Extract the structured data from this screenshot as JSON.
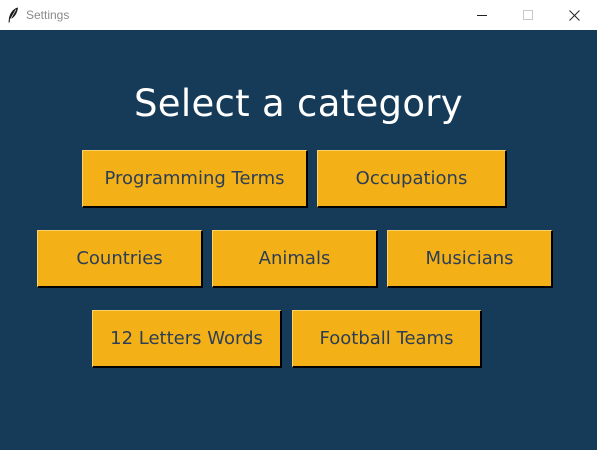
{
  "window": {
    "title": "Settings",
    "app_icon": "feather-icon",
    "controls": {
      "minimize_icon": "minimize-icon",
      "maximize_icon": "maximize-icon",
      "close_icon": "close-icon"
    }
  },
  "main": {
    "heading": "Select a category",
    "categories": [
      {
        "label": "Programming Terms"
      },
      {
        "label": "Occupations"
      },
      {
        "label": "Countries"
      },
      {
        "label": "Animals"
      },
      {
        "label": "Musicians"
      },
      {
        "label": "12 Letters Words"
      },
      {
        "label": "Football Teams"
      }
    ]
  },
  "colors": {
    "background": "#163b59",
    "button": "#f4b117",
    "button_text": "#2c3e55",
    "heading_text": "#ffffff"
  }
}
